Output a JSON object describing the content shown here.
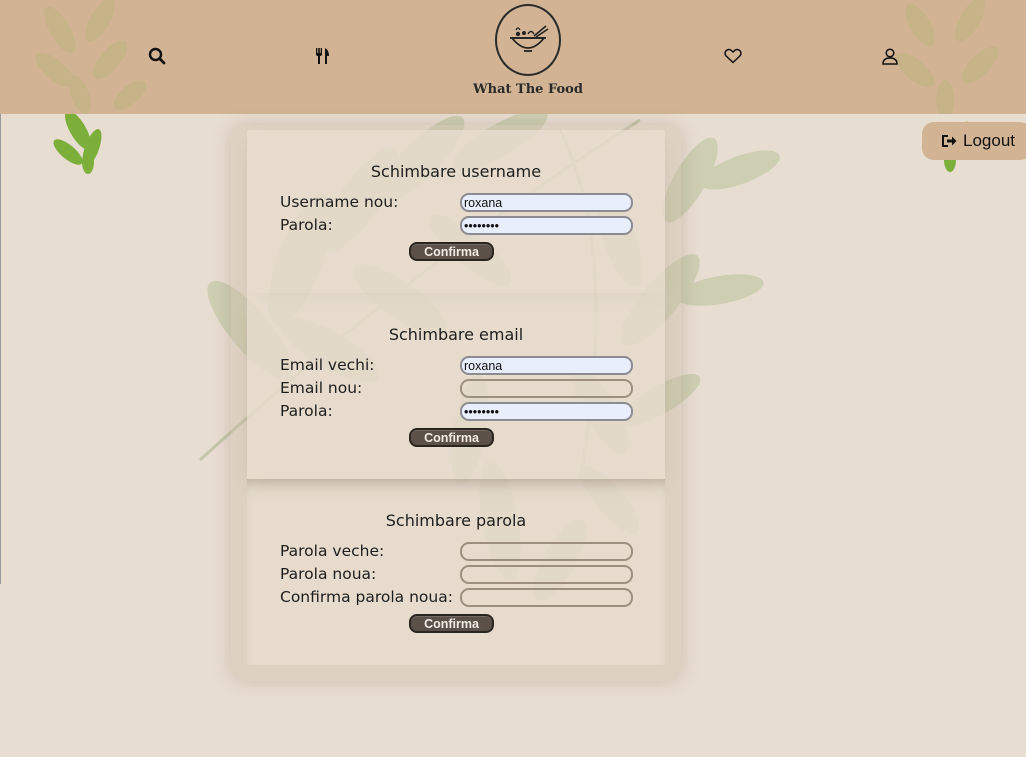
{
  "brand": {
    "name": "What The Food"
  },
  "nav": {
    "icons": [
      "search-icon",
      "fork-knife-icon",
      "heart-icon",
      "user-icon"
    ]
  },
  "logout": {
    "label": "Logout"
  },
  "username_section": {
    "title": "Schimbare username",
    "new_username_label": "Username nou:",
    "new_username_value": "roxana",
    "password_label": "Parola:",
    "password_value": "••••••••",
    "confirm_label": "Confirma"
  },
  "email_section": {
    "title": "Schimbare email",
    "old_email_label": "Email vechi:",
    "old_email_value": "roxana",
    "new_email_label": "Email nou:",
    "new_email_value": "",
    "password_label": "Parola:",
    "password_value": "••••••••",
    "confirm_label": "Confirma"
  },
  "password_section": {
    "title": "Schimbare parola",
    "old_password_label": "Parola veche:",
    "new_password_label": "Parola noua:",
    "confirm_new_password_label": "Confirma parola noua:",
    "confirm_label": "Confirma"
  },
  "colors": {
    "header": "#d2b494",
    "background": "#e8ddd1",
    "button": "#5c5148",
    "field_filled": "#e8eefc"
  }
}
